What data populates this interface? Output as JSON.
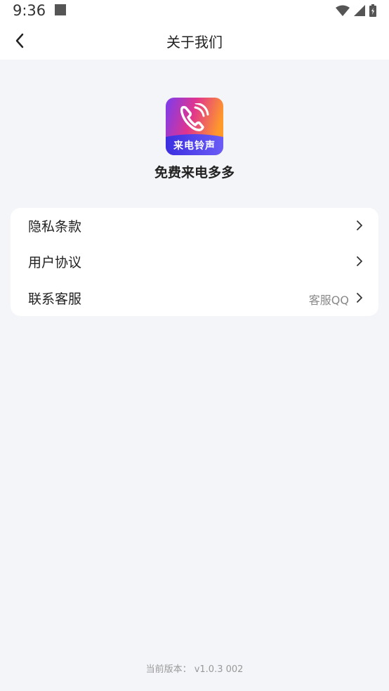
{
  "status_bar": {
    "time": "9:36"
  },
  "header": {
    "title": "关于我们"
  },
  "app": {
    "logo_text": "来电铃声",
    "name": "免费来电多多"
  },
  "menu": {
    "items": [
      {
        "label": "隐私条款",
        "value": ""
      },
      {
        "label": "用户协议",
        "value": ""
      },
      {
        "label": "联系客服",
        "value": "客服QQ"
      }
    ]
  },
  "footer": {
    "version": "当前版本： v1.0.3 002"
  },
  "colors": {
    "background": "#f4f5f8",
    "card": "#ffffff",
    "text": "#222222",
    "muted": "#888888"
  }
}
